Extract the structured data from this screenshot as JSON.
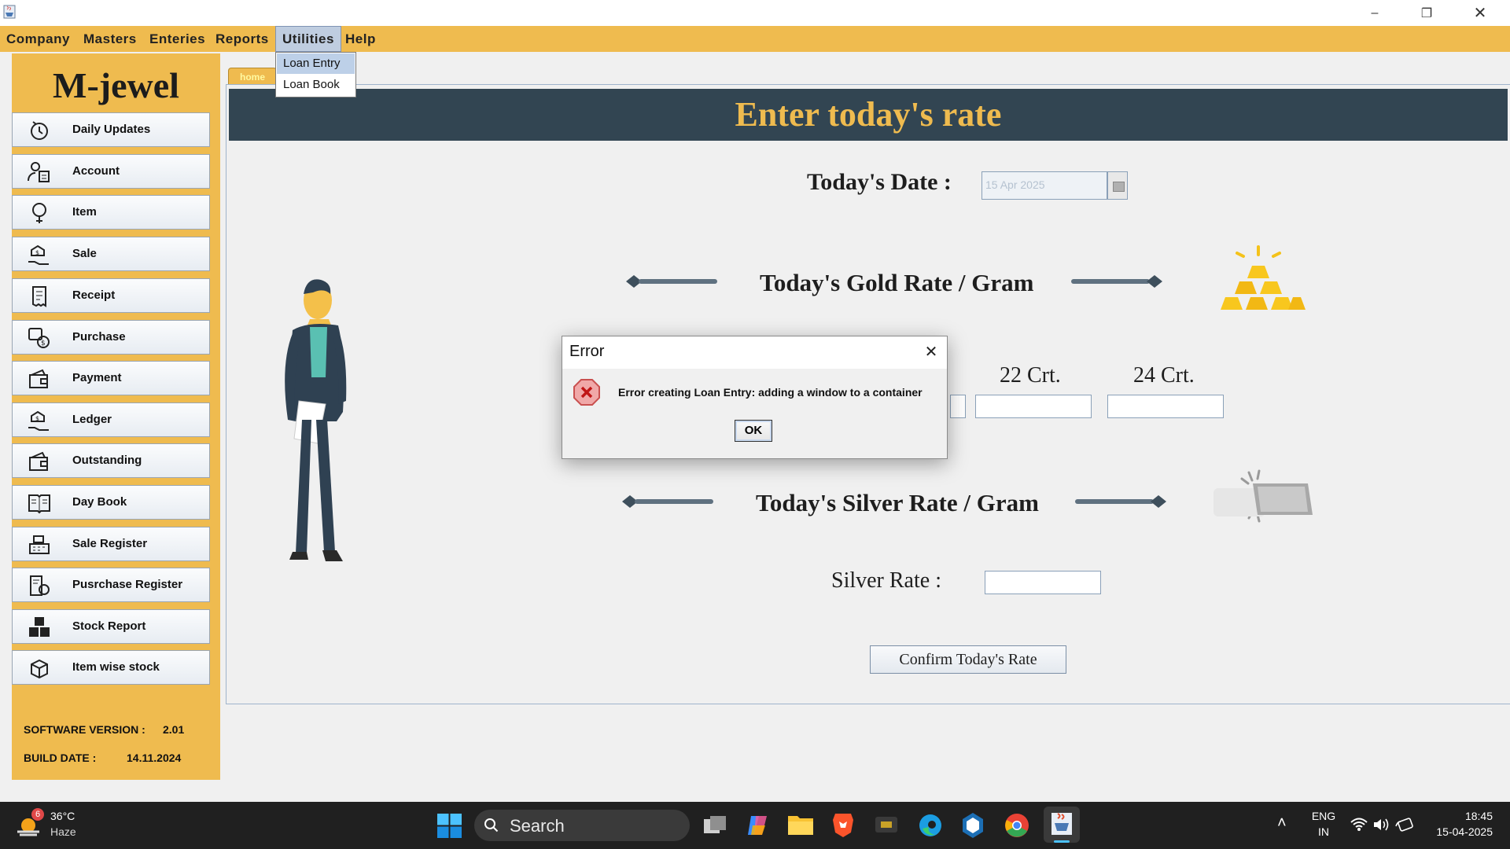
{
  "menubar": {
    "items": [
      "Company",
      "Masters",
      "Enteries",
      "Reports",
      "Utilities",
      "Help"
    ],
    "active": "Utilities",
    "dropdown": [
      "Loan Entry",
      "Loan Book"
    ]
  },
  "sidebar": {
    "brand": "M-jewel",
    "items": [
      {
        "label": "Daily Updates",
        "icon": "daily-updates-icon"
      },
      {
        "label": "Account",
        "icon": "account-icon"
      },
      {
        "label": "Item",
        "icon": "item-icon"
      },
      {
        "label": "Sale",
        "icon": "sale-icon"
      },
      {
        "label": "Receipt",
        "icon": "receipt-icon"
      },
      {
        "label": "Purchase",
        "icon": "purchase-icon"
      },
      {
        "label": "Payment",
        "icon": "wallet-icon"
      },
      {
        "label": "Ledger",
        "icon": "ledger-icon"
      },
      {
        "label": "Outstanding",
        "icon": "wallet-icon"
      },
      {
        "label": "Day Book",
        "icon": "book-icon"
      },
      {
        "label": "Sale Register",
        "icon": "cash-register-icon"
      },
      {
        "label": "Pusrchase Register",
        "icon": "purchase-register-icon"
      },
      {
        "label": "Stock Report",
        "icon": "boxes-icon"
      },
      {
        "label": "Item wise stock",
        "icon": "box-icon"
      }
    ],
    "version_label": "SOFTWARE VERSION :",
    "version_value": "2.01",
    "build_label": "BUILD DATE :",
    "build_value": "14.11.2024"
  },
  "main": {
    "tab_label": "home",
    "headline": "Enter today's rate",
    "date_label": "Today's Date :",
    "date_value": "15 Apr 2025",
    "gold_heading": "Today's Gold Rate / Gram",
    "carat_22": "22 Crt.",
    "carat_24": "24 Crt.",
    "silver_heading": "Today's Silver Rate / Gram",
    "silver_label": "Silver Rate :",
    "confirm_button": "Confirm  Today's Rate"
  },
  "dialog": {
    "title": "Error",
    "message": "Error creating Loan Entry: adding a window to a container",
    "ok_label": "OK"
  },
  "taskbar": {
    "weather_temp": "36°C",
    "weather_desc": "Haze",
    "weather_badge": "6",
    "search_placeholder": "Search",
    "lang_line1": "ENG",
    "lang_line2": "IN",
    "time": "18:45",
    "date": "15-04-2025"
  },
  "colors": {
    "accent": "#efbb4f",
    "header_bg": "#324552",
    "taskbar_bg": "#202020"
  }
}
